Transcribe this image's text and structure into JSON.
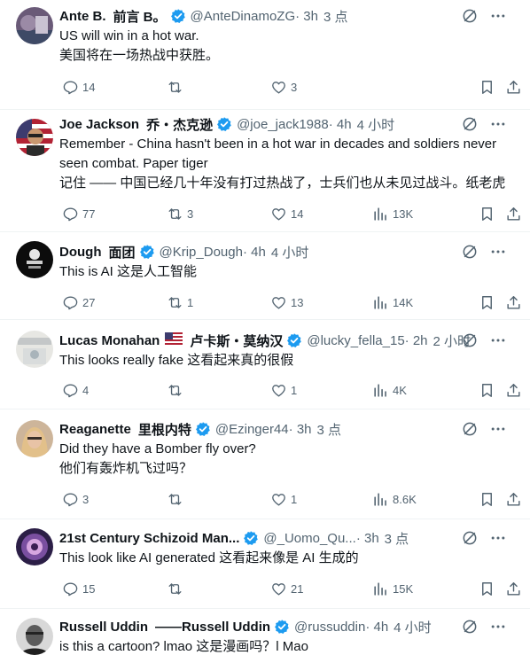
{
  "tweets": [
    {
      "name": "Ante B.",
      "name_tr": "前言 B。",
      "verified": true,
      "flag": "",
      "handle": "@AnteDinamoZG",
      "time": "· 3h",
      "time_tr": "3 点",
      "lines": [
        "US will win in a hot war.",
        "美国将在一场热战中获胜。"
      ],
      "replies": "14",
      "retweets": "",
      "likes": "3",
      "views": "",
      "show_views": false
    },
    {
      "name": "Joe Jackson",
      "name_tr": "乔・杰克逊",
      "verified": true,
      "flag": "",
      "handle": "@joe_jack1988",
      "time": "· 4h",
      "time_tr": "4 小时",
      "lines": [
        "Remember - China hasn't been in a hot war in decades and soldiers never",
        "seen combat. Paper tiger",
        "记住 —— 中国已经几十年没有打过热战了，士兵们也从未见过战斗。纸老虎"
      ],
      "replies": "77",
      "retweets": "3",
      "likes": "14",
      "views": "13K",
      "show_views": true
    },
    {
      "name": "Dough",
      "name_tr": "面团",
      "verified": true,
      "flag": "",
      "handle": "@Krip_Dough",
      "time": "· 4h",
      "time_tr": "4 小时",
      "lines": [
        "This is AI  这是人工智能"
      ],
      "replies": "27",
      "retweets": "1",
      "likes": "13",
      "views": "14K",
      "show_views": true
    },
    {
      "name": "Lucas Monahan",
      "name_tr": "卢卡斯・莫纳汉",
      "verified": true,
      "flag": "us",
      "handle": "@lucky_fella_15",
      "time": "· 2h",
      "time_tr": "2 小时",
      "lines": [
        "This looks really fake  这看起来真的很假"
      ],
      "replies": "4",
      "retweets": "",
      "likes": "1",
      "views": "4K",
      "show_views": true
    },
    {
      "name": "Reaganette",
      "name_tr": "里根内特",
      "verified": true,
      "flag": "",
      "handle": "@Ezinger44",
      "time": "· 3h",
      "time_tr": "3 点",
      "lines": [
        "Did they have a Bomber fly over?",
        "他们有轰炸机飞过吗？"
      ],
      "replies": "3",
      "retweets": "",
      "likes": "1",
      "views": "8.6K",
      "show_views": true
    },
    {
      "name": "21st Century Schizoid Man...",
      "name_tr": "",
      "verified": true,
      "flag": "",
      "handle": "@_Uomo_Qu...",
      "time": "· 3h",
      "time_tr": "3 点",
      "lines": [
        "This look like AI generated  这看起来像是 AI 生成的"
      ],
      "replies": "15",
      "retweets": "",
      "likes": "21",
      "views": "15K",
      "show_views": true
    },
    {
      "name": "Russell Uddin",
      "name_tr": "——Russell Uddin",
      "verified": true,
      "flag": "",
      "handle": "@russuddin",
      "time": "· 4h",
      "time_tr": "4 小时",
      "lines": [
        "is this a cartoon? lmao  这是漫画吗？l Mao"
      ],
      "replies": "",
      "retweets": "",
      "likes": "",
      "views": "",
      "show_views": false
    }
  ],
  "icons": {
    "header": [
      "grok-icon",
      "more-icon"
    ],
    "actions": [
      "reply-icon",
      "retweet-icon",
      "like-icon",
      "views-icon",
      "bookmark-icon",
      "share-icon"
    ]
  },
  "colors": {
    "verified": "#1d9bf0",
    "muted": "#536471",
    "text": "#0f1419",
    "divider": "#eff3f4"
  }
}
